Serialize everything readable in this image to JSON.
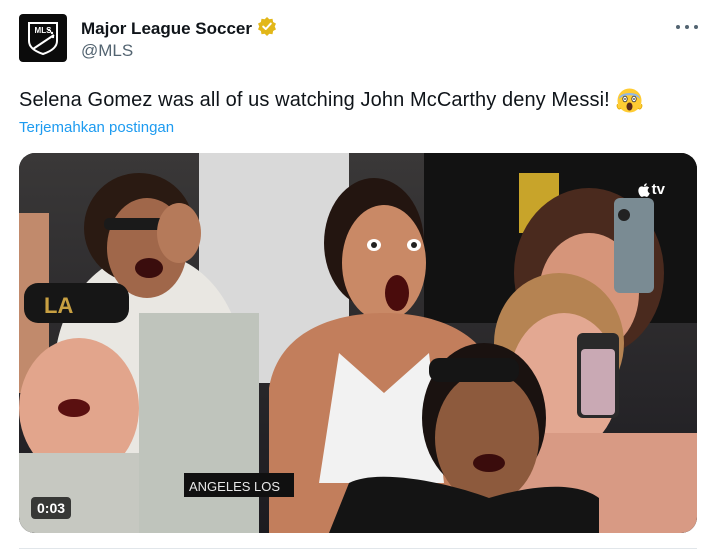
{
  "account": {
    "display_name": "Major League Soccer",
    "handle": "@MLS",
    "avatar_text": "MLS",
    "verified": true,
    "verified_color": "#e2b719"
  },
  "tweet": {
    "text": "Selena Gomez was all of us watching John McCarthy deny Messi!",
    "emoji": "face-screaming-in-fear",
    "translate_label": "Terjemahkan postingan"
  },
  "media": {
    "type": "video",
    "timestamp": "0:03",
    "watermark": "tv",
    "sign_text": "ANGELES LOS",
    "cap_text": "LA"
  },
  "icons": {
    "more": "more-horizontal-icon",
    "verified": "verified-badge-icon",
    "apple": "apple-logo-icon"
  },
  "colors": {
    "link": "#1d9bf0",
    "secondary_text": "#536471",
    "primary_text": "#0f1419"
  }
}
